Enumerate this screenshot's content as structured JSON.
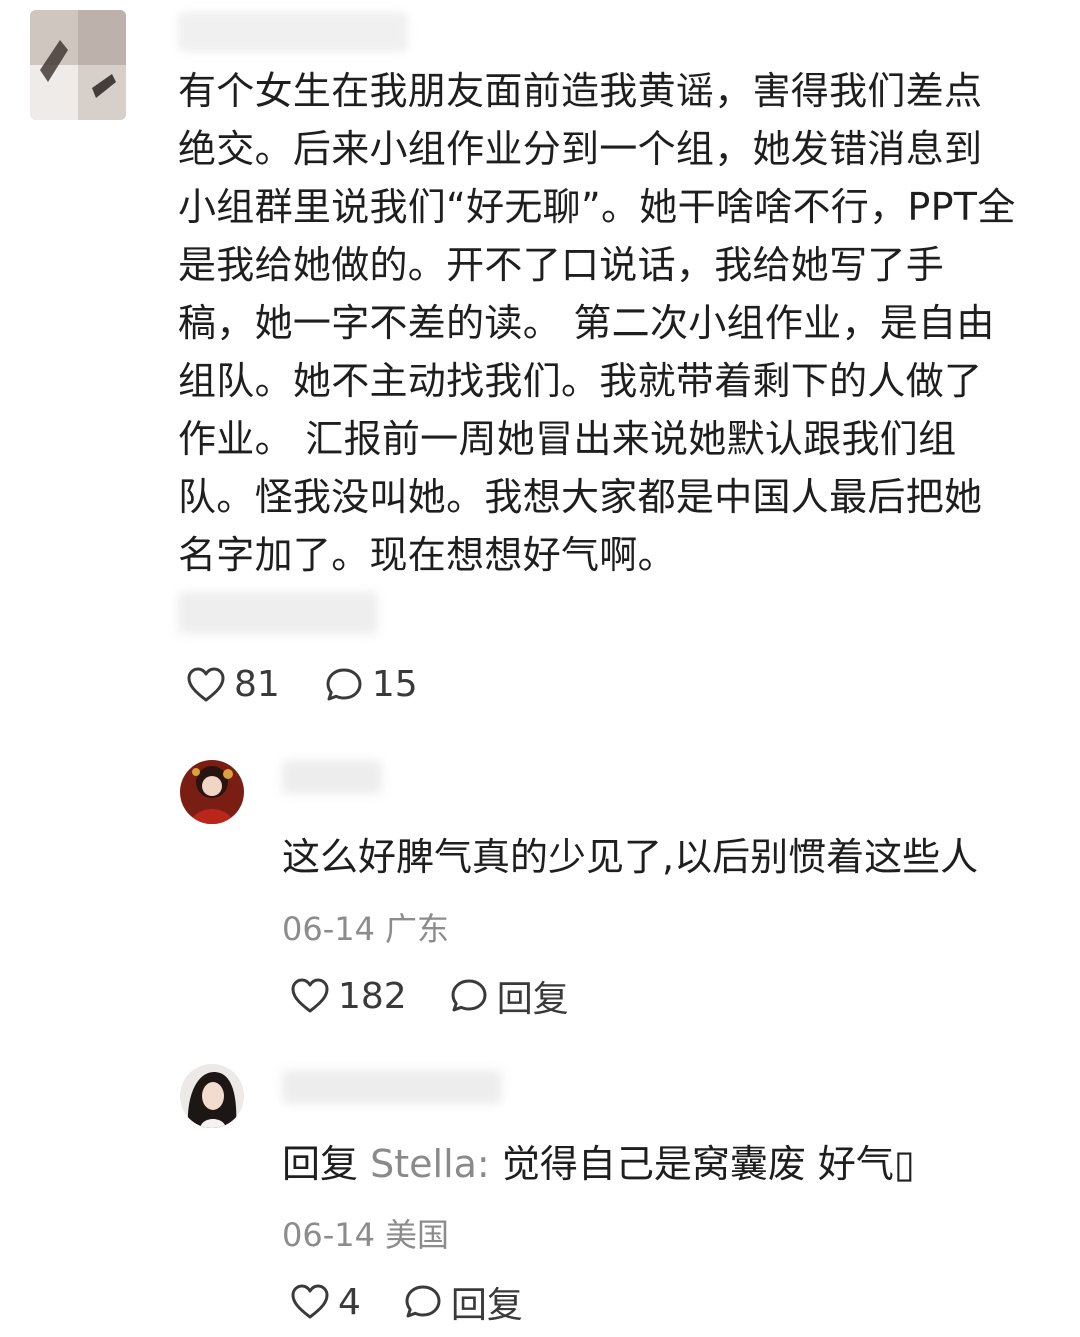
{
  "main_comment": {
    "text": "有个女生在我朋友面前造我黄谣，害得我们差点\n绝交。后来小组作业分到一个组，她发错消息到\n小组群里说我们“好无聊”。她干啥啥不行，PPT全\n是我给她做的。开不了口说话，我给她写了手\n稿，她一字不差的读。 第二次小组作业，是自由\n组队。她不主动找我们。我就带着剩下的人做了\n作业。 汇报前一周她冒出来说她默认跟我们组\n队。怪我没叫她。我想大家都是中国人最后把她\n名字加了。现在想想好气啊。",
    "likes": "81",
    "comments": "15",
    "like_icon": "heart-outline-icon",
    "comment_icon": "speech-bubble-icon"
  },
  "replies": [
    {
      "text": "这么好脾气真的少见了,以后别惯着这些人",
      "date": "06-14",
      "location": "广东",
      "likes": "182",
      "reply_label": "回复"
    },
    {
      "prefix": "回复",
      "mention": "Stella:",
      "text": "觉得自己是窝囊废 好气▯",
      "date": "06-14",
      "location": "美国",
      "likes": "4",
      "reply_label": "回复"
    }
  ],
  "colors": {
    "text_primary": "#1e1e1e",
    "text_secondary": "#8c8c8c",
    "icon": "#3a3a3a"
  }
}
